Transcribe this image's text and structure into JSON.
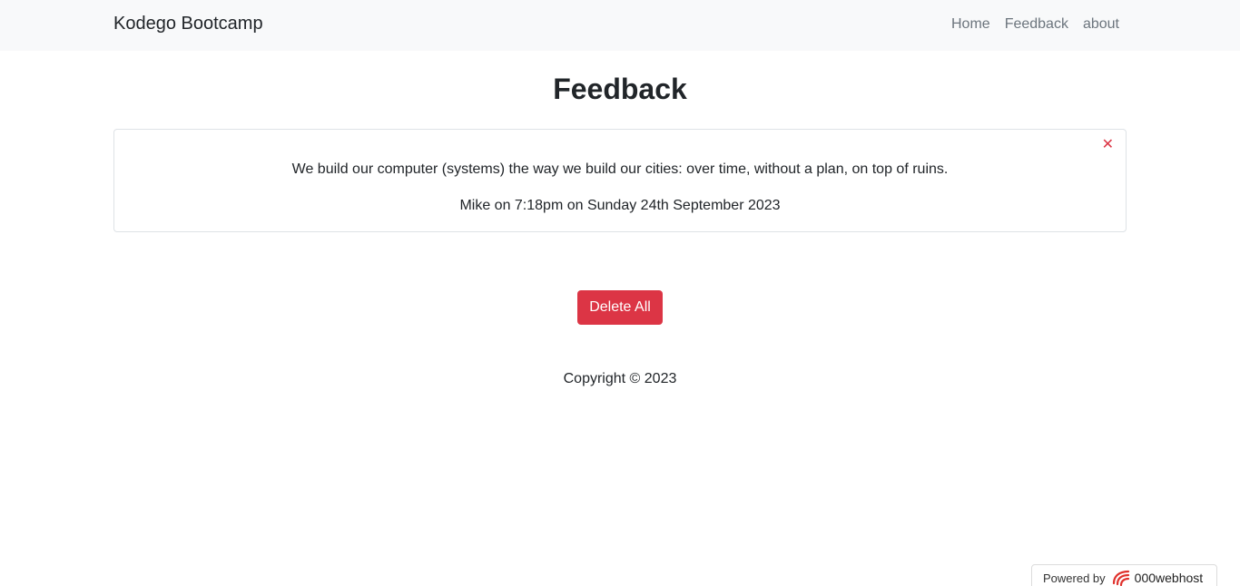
{
  "navbar": {
    "brand": "Kodego Bootcamp",
    "links": [
      "Home",
      "Feedback",
      "about"
    ]
  },
  "page": {
    "title": "Feedback"
  },
  "feedback_card": {
    "close_glyph": "✕",
    "quote": "We build our computer (systems) the way we build our cities: over time, without a plan, on top of ruins.",
    "meta": "Mike on 7:18pm on Sunday 24th September 2023"
  },
  "actions": {
    "delete_all_label": "Delete All"
  },
  "footer": {
    "copyright": "Copyright © 2023"
  },
  "badge": {
    "powered_by": "Powered by",
    "host_name": "000webhost"
  },
  "colors": {
    "navbar_bg": "#f8f9fa",
    "danger": "#dc3545",
    "text": "#212529",
    "muted": "#6c757d"
  }
}
